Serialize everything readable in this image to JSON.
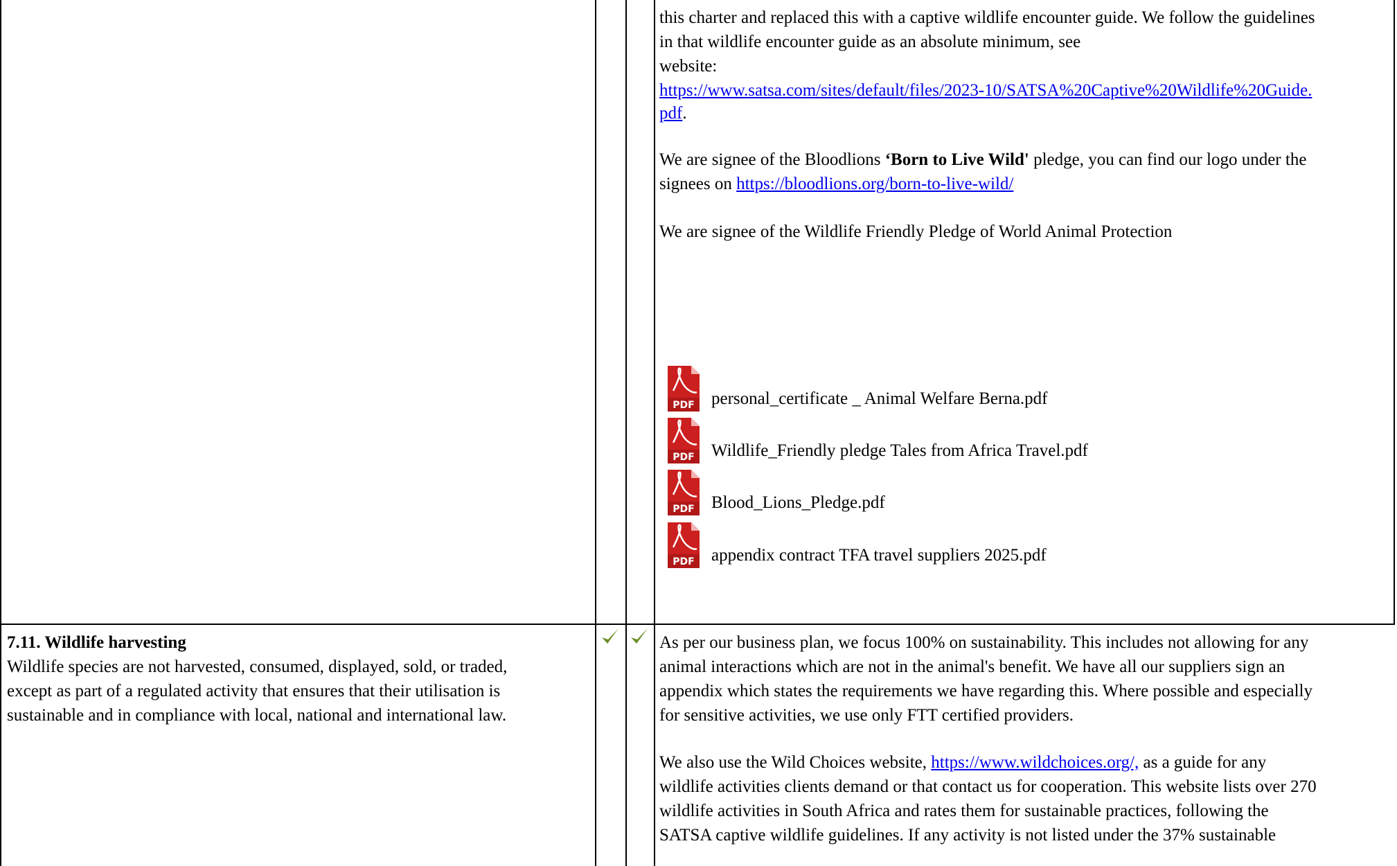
{
  "top_cell": {
    "lines": [
      "this charter and replaced this with a captive wildlife encounter guide. We follow the guidelines",
      "in that wildlife encounter guide as an absolute minimum, see",
      "website:"
    ],
    "satsa_link_line1": "https://www.satsa.com/sites/default/files/2023-10/SATSA%20Captive%20Wildlife%20Guide.",
    "satsa_link_line2": "pdf",
    "satsa_link_trailing": ".",
    "bloodlions_pre": "We are signee of the Bloodlions ",
    "bloodlions_bold": "‘Born to Live Wild'",
    "bloodlions_post": " pledge, you can find our logo under the",
    "bloodlions_line2_pre": "signees on ",
    "bloodlions_link": "https://bloodlions.org/born-to-live-wild/",
    "wap_pledge": "We are signee of the Wildlife Friendly Pledge of World Animal Protection",
    "attachments": [
      {
        "name": "personal_certificate _ Animal Welfare Berna.pdf",
        "icon": "pdf-file-icon",
        "badge": "PDF"
      },
      {
        "name": "Wildlife_Friendly pledge Tales from Africa Travel.pdf",
        "icon": "pdf-file-icon",
        "badge": "PDF"
      },
      {
        "name": "Blood_Lions_Pledge.pdf",
        "icon": "pdf-file-icon",
        "badge": "PDF"
      },
      {
        "name": "appendix contract TFA travel suppliers 2025.pdf",
        "icon": "pdf-file-icon",
        "badge": "PDF"
      }
    ]
  },
  "criterion": {
    "title": "7.11. Wildlife harvesting",
    "description_lines": [
      "Wildlife species are not harvested, consumed, displayed, sold, or traded,",
      "except as part of a regulated activity that ensures that their utilisation is",
      "sustainable and in compliance with local, national and international law."
    ],
    "check1_icon": "checkmark-icon",
    "check2_icon": "checkmark-icon",
    "check_color": "#6b8e23",
    "response_p1": [
      "As per our business plan, we focus 100% on sustainability. This includes not allowing for any",
      "animal interactions which are not in the animal's benefit. We have all our suppliers sign an",
      "appendix which states the requirements we have regarding this. Where possible and especially",
      "for sensitive activities, we use only FTT certified providers."
    ],
    "response_p2_pre": "We also use the Wild Choices website, ",
    "wildchoices_link": "https://www.wildchoices.org/,",
    "response_p2_post": " as a guide for any",
    "response_p2_rest": [
      "wildlife activities clients demand or that contact us for cooperation. This website lists over 270",
      "wildlife activities in South Africa and rates them for sustainable practices, following the",
      "SATSA captive wildlife guidelines. If any activity is not listed under the 37% sustainable"
    ]
  },
  "colors": {
    "link": "#0000ee",
    "pdf_red": "#cc1f1f",
    "border": "#000000"
  }
}
